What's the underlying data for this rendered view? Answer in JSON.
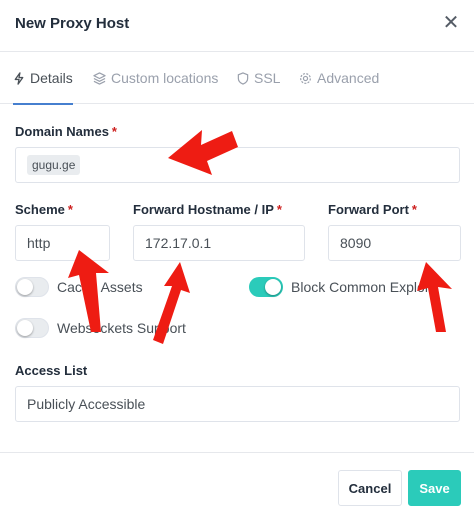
{
  "header": {
    "title": "New Proxy Host",
    "close_icon": "close-icon"
  },
  "tabs": [
    {
      "label": "Details",
      "icon": "bolt-icon",
      "active": true
    },
    {
      "label": "Custom locations",
      "icon": "layers-icon",
      "active": false
    },
    {
      "label": "SSL",
      "icon": "shield-icon",
      "active": false
    },
    {
      "label": "Advanced",
      "icon": "gear-icon",
      "active": false
    }
  ],
  "form": {
    "domain_names": {
      "label": "Domain Names",
      "required": "*",
      "chip": "gugu.ge"
    },
    "scheme": {
      "label": "Scheme",
      "required": "*",
      "value": "http"
    },
    "forward_hostname": {
      "label": "Forward Hostname / IP",
      "required": "*",
      "value": "172.17.0.1"
    },
    "forward_port": {
      "label": "Forward Port",
      "required": "*",
      "value": "8090"
    },
    "toggles": [
      {
        "label": "Cache Assets",
        "on": false
      },
      {
        "label": "Block Common Exploits",
        "on": true
      },
      {
        "label": "Websockets Support",
        "on": false
      }
    ],
    "access_list": {
      "label": "Access List",
      "value": "Publicly Accessible"
    }
  },
  "footer": {
    "cancel_label": "Cancel",
    "save_label": "Save"
  },
  "colors": {
    "accent": "#2bcbba",
    "tab_active": "#467fcf",
    "required": "#cd201f",
    "arrow": "#ee1c13"
  }
}
